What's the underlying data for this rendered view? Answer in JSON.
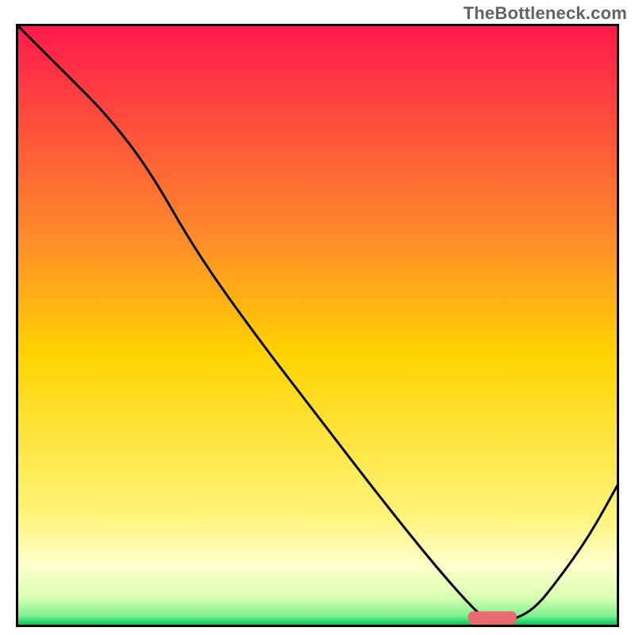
{
  "watermark": "TheBottleneck.com",
  "colors": {
    "gradient_top": "#ff1a4b",
    "gradient_mid": "#ffd400",
    "gradient_yellowwhite": "#ffffa8",
    "gradient_green": "#00d060",
    "curve": "#000000",
    "marker": "#e96a6f",
    "frame": "#000000"
  },
  "chart_data": {
    "type": "line",
    "title": "",
    "xlabel": "",
    "ylabel": "",
    "xlim": [
      0,
      100
    ],
    "ylim": [
      0,
      100
    ],
    "grid": false,
    "legend": false,
    "series": [
      {
        "name": "bottleneck-curve",
        "x": [
          0,
          8,
          15,
          22,
          30,
          40,
          50,
          60,
          68,
          74,
          78,
          82,
          86,
          90,
          95,
          100
        ],
        "values": [
          100,
          92,
          85,
          76,
          62,
          48,
          35,
          22,
          12,
          5,
          1,
          1,
          3,
          8,
          15,
          24
        ]
      }
    ],
    "marker": {
      "x": 79,
      "y": 1.5,
      "width": 8,
      "height": 2.2
    },
    "background_gradient": {
      "stops": [
        {
          "offset": 0.0,
          "color": "#ff1a4b"
        },
        {
          "offset": 0.35,
          "color": "#ff8a2a"
        },
        {
          "offset": 0.55,
          "color": "#ffd400"
        },
        {
          "offset": 0.82,
          "color": "#fff47a"
        },
        {
          "offset": 0.9,
          "color": "#ffffcc"
        },
        {
          "offset": 0.955,
          "color": "#d8ffb0"
        },
        {
          "offset": 0.985,
          "color": "#7ff090"
        },
        {
          "offset": 1.0,
          "color": "#00c85a"
        }
      ]
    }
  }
}
